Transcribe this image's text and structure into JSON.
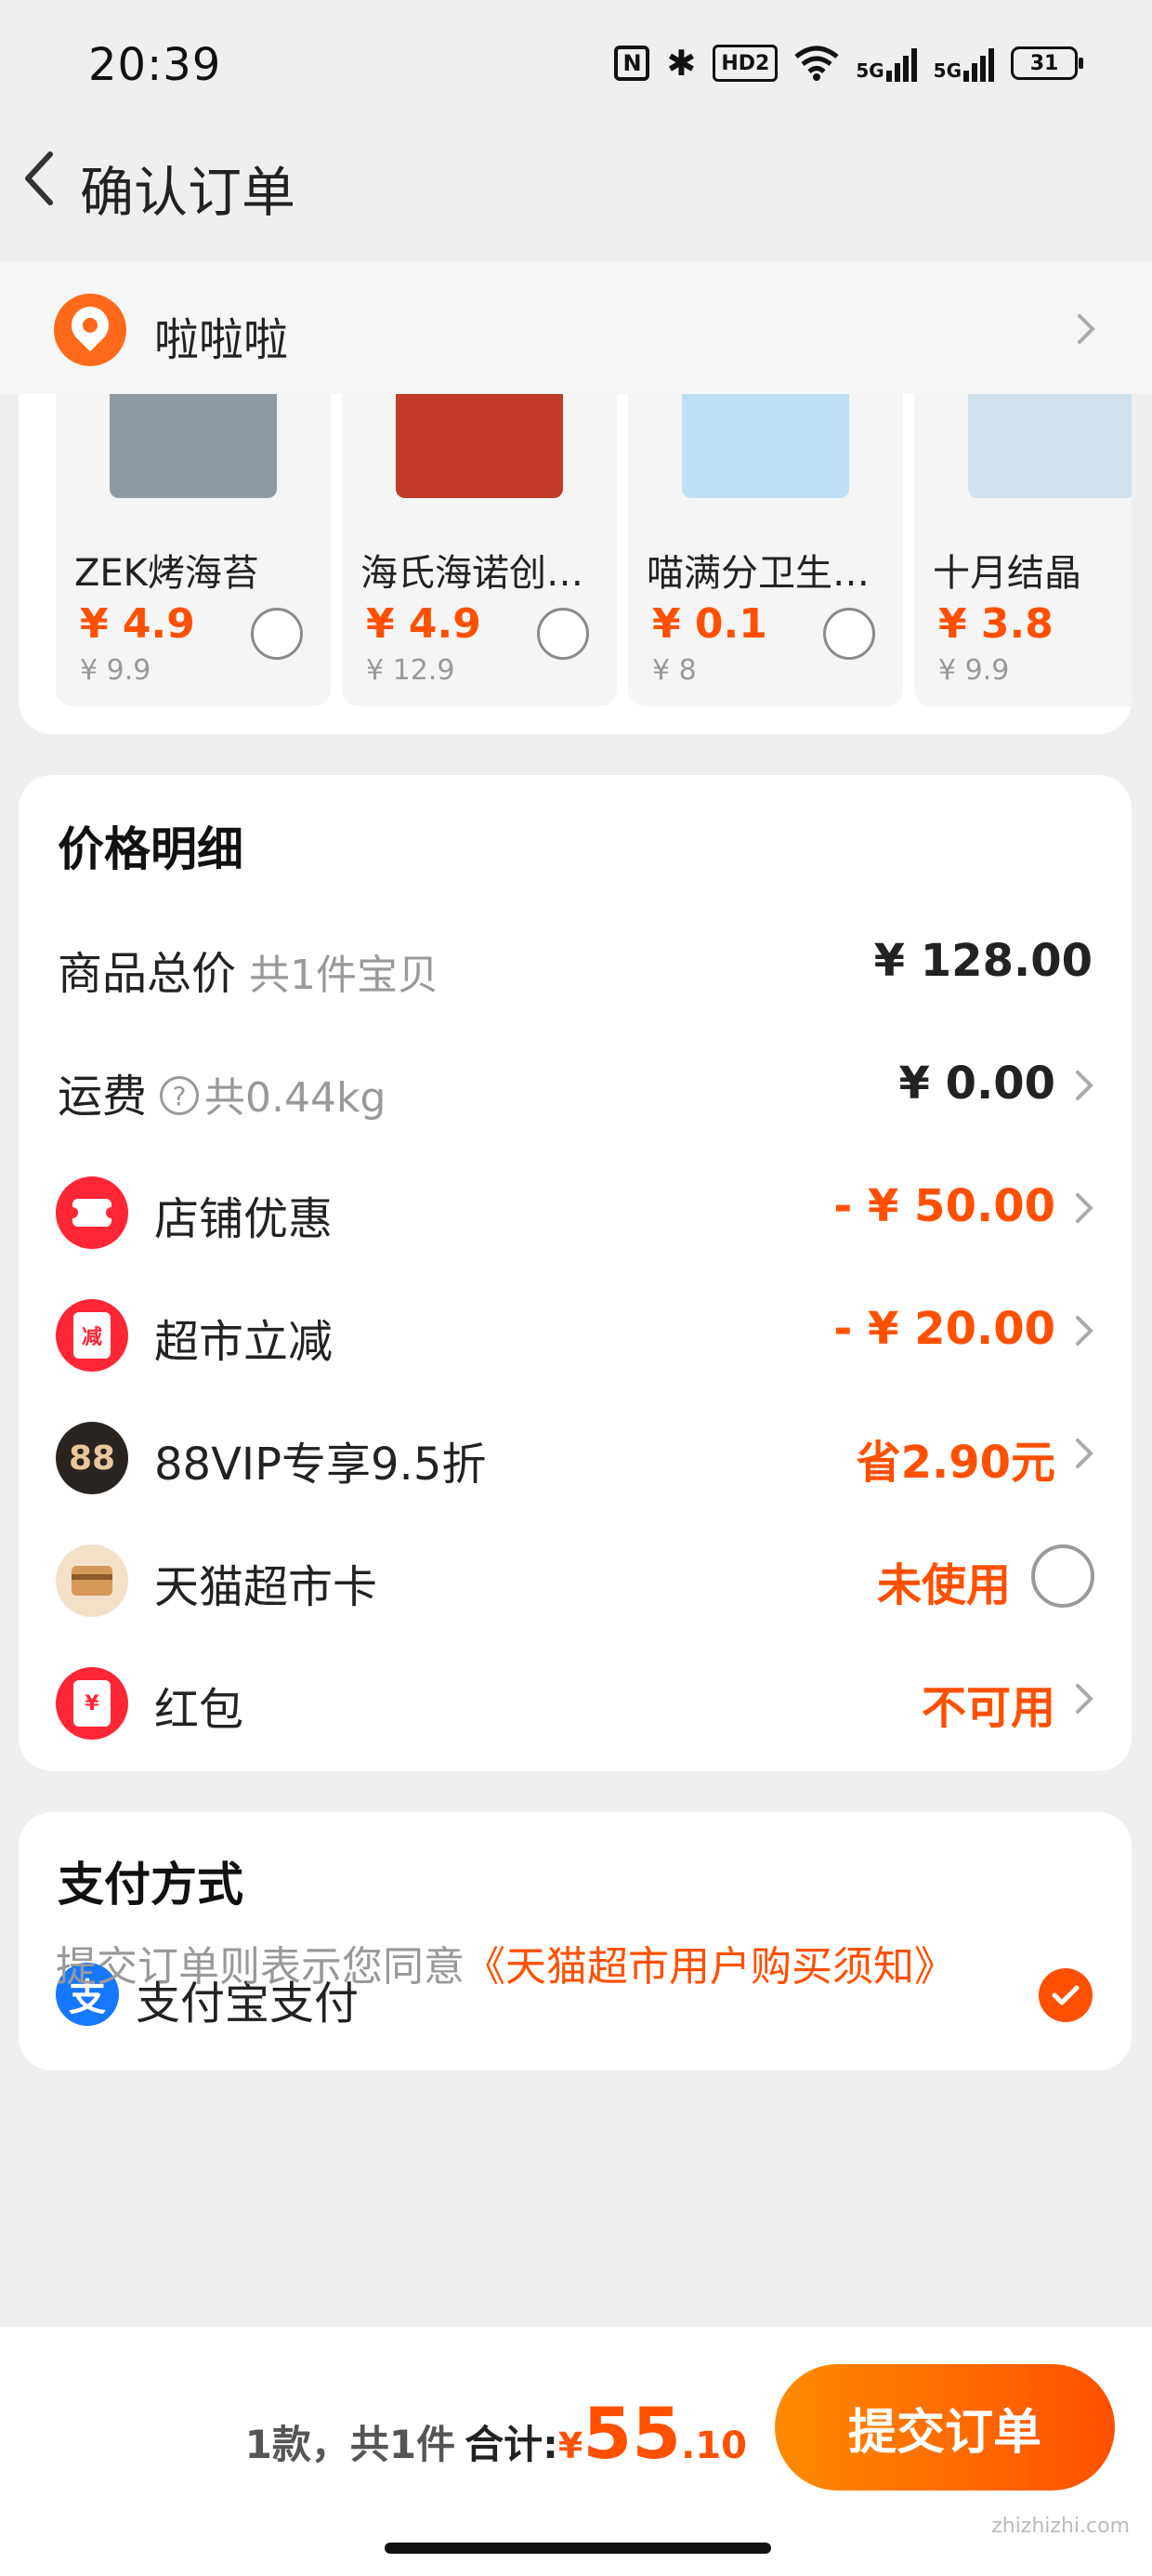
{
  "status_bar": {
    "time": "20:39",
    "battery": "31",
    "hd": "HD2",
    "signal1": "5G",
    "signal2": "5G"
  },
  "nav": {
    "title": "确认订单"
  },
  "address": {
    "name": "啦啦啦"
  },
  "products": [
    {
      "name": "ZEK烤海苔",
      "price": "¥ 4.9",
      "original": "¥ 9.9",
      "img_color": "#8e9aa3"
    },
    {
      "name": "海氏海诺创可…",
      "price": "¥ 4.9",
      "original": "¥ 12.9",
      "img_color": "#c23a2a"
    },
    {
      "name": "喵满分卫生除…",
      "price": "¥ 0.1",
      "original": "¥ 8",
      "img_color": "#bfe0f4"
    },
    {
      "name": "十月结晶",
      "price": "¥ 3.8",
      "original": "¥ 9.9",
      "img_color": "#cfe2ee"
    }
  ],
  "price_detail": {
    "title": "价格明细",
    "rows": [
      {
        "label": "商品总价",
        "sub": "共1件宝贝",
        "value": "¥ 128.00"
      },
      {
        "label": "运费",
        "sub": "共0.44kg",
        "value": "¥ 0.00"
      },
      {
        "label": "店铺优惠",
        "value": "- ¥ 50.00"
      },
      {
        "label": "超市立减",
        "icon_text": "减",
        "value": "- ¥ 20.00"
      },
      {
        "label": "88VIP专享9.5折",
        "icon_text": "88",
        "value": "省2.90元"
      },
      {
        "label": "天猫超市卡",
        "value": "未使用"
      },
      {
        "label": "红包",
        "icon_text": "¥",
        "value": "不可用"
      }
    ]
  },
  "payment": {
    "title": "支付方式",
    "method": "支付宝支付",
    "icon_text": "支"
  },
  "agreement": {
    "text": "提交订单则表示您同意",
    "link": "《天猫超市用户购买须知》"
  },
  "bottom": {
    "count": "1款，共1件",
    "total_label": "合计:",
    "yen": "¥",
    "total_int": "55",
    "total_dec": ".10",
    "submit": "提交订单"
  },
  "watermark": "zhizhizhi.com",
  "colors": {
    "accent": "#ff5000",
    "bg": "#efefef",
    "card": "#ffffff",
    "alipay": "#1677ff"
  }
}
